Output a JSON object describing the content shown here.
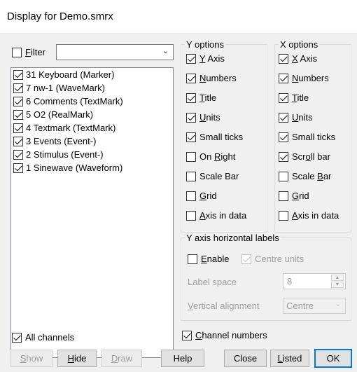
{
  "window": {
    "title": "Display for Demo.smrx"
  },
  "filter": {
    "label": "Filter",
    "checked": false,
    "value": ""
  },
  "channels": [
    {
      "label": "31 Keyboard (Marker)",
      "checked": true
    },
    {
      "label": "7 nw-1 (WaveMark)",
      "checked": true
    },
    {
      "label": "6 Comments (TextMark)",
      "checked": true
    },
    {
      "label": "5 O2 (RealMark)",
      "checked": true
    },
    {
      "label": "4 Textmark (TextMark)",
      "checked": true
    },
    {
      "label": "3 Events (Event-)",
      "checked": true
    },
    {
      "label": "2 Stimulus (Event-)",
      "checked": true
    },
    {
      "label": "1 Sinewave (Waveform)",
      "checked": true
    }
  ],
  "y_options": {
    "legend": "Y options",
    "y_axis": "Y Axis",
    "numbers": "Numbers",
    "title": "Title",
    "units": "Units",
    "small_ticks": "Small ticks",
    "on_right": "On Right",
    "scale_bar": "Scale Bar",
    "grid": "Grid",
    "axis_in_data": "Axis in data"
  },
  "x_options": {
    "legend": "X options",
    "x_axis": "X Axis",
    "numbers": "Numbers",
    "title": "Title",
    "units": "Units",
    "small_ticks": "Small ticks",
    "scroll_bar": "Scroll bar",
    "scale_bar": "Scale Bar",
    "grid": "Grid",
    "axis_in_data": "Axis in data"
  },
  "y_axis_labels": {
    "legend": "Y axis horizontal labels",
    "enable": "Enable",
    "centre_units": "Centre units",
    "label_space_label": "Label space",
    "label_space_value": "8",
    "vertical_alignment_label": "Vertical alignment",
    "vertical_alignment_value": "Centre"
  },
  "all_channels": {
    "label": "All channels",
    "checked": true
  },
  "channel_numbers": {
    "label": "Channel numbers",
    "checked": true
  },
  "buttons": {
    "show": "Show",
    "hide": "Hide",
    "draw": "Draw",
    "help": "Help",
    "close": "Close",
    "listed": "Listed",
    "ok": "OK"
  }
}
